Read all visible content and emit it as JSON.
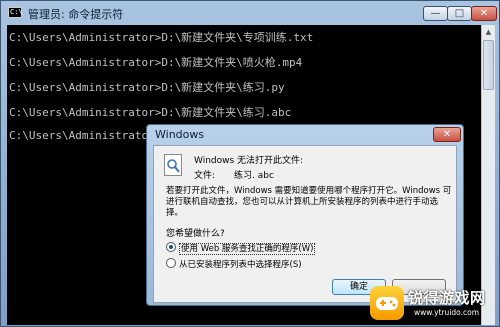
{
  "window": {
    "title": "管理员: 命令提示符",
    "icon_text": "C:\\",
    "minimize_glyph": "—",
    "maximize_glyph": "□",
    "close_glyph": "✕"
  },
  "console": {
    "lines": [
      "C:\\Users\\Administrator>D:\\新建文件夹\\专项训练.txt",
      "C:\\Users\\Administrator>D:\\新建文件夹\\喷火枪.mp4",
      "C:\\Users\\Administrator>D:\\新建文件夹\\练习.py",
      "C:\\Users\\Administrator>D:\\新建文件夹\\练习.abc",
      "C:\\Users\\Administrator>"
    ]
  },
  "dialog": {
    "title": "Windows",
    "close_glyph": "✕",
    "message_title": "Windows 无法打开此文件:",
    "file_label": "文件:",
    "file_name": "练习. abc",
    "description": "若要打开此文件，Windows 需要知道要使用哪个程序打开它。Windows 可进行联机自动查找，您也可以从计算机上所安装程序的列表中进行手动选择。",
    "question": "您希望做什么?",
    "options": [
      {
        "label": "使用 Web 服务查找正确的程序(W)",
        "selected": true
      },
      {
        "label": "从已安装程序列表中选择程序(S)",
        "selected": false
      }
    ],
    "ok_label": "确定",
    "icon": "file-question-icon"
  },
  "watermark": {
    "name": "锐得游戏网",
    "url": "www.ytruido.com"
  }
}
